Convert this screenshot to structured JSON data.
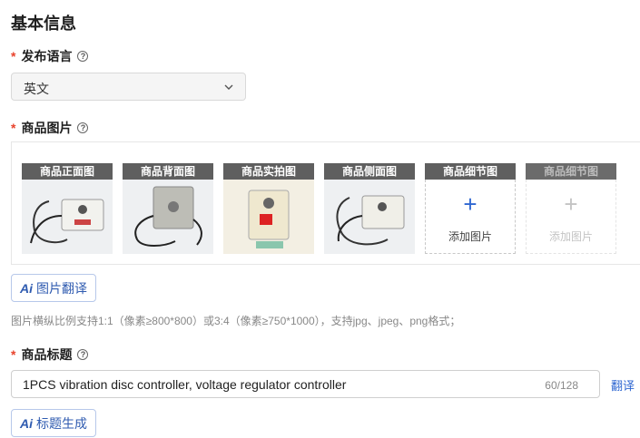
{
  "section_title": "基本信息",
  "language": {
    "label": "发布语言",
    "value": "英文"
  },
  "images": {
    "label": "商品图片",
    "slots": [
      {
        "title": "商品正面图"
      },
      {
        "title": "商品背面图"
      },
      {
        "title": "商品实拍图"
      },
      {
        "title": "商品侧面图"
      }
    ],
    "upload_slots": [
      {
        "title": "商品细节图",
        "text": "添加图片",
        "plus": "+",
        "enabled": true
      },
      {
        "title": "商品细节图",
        "text": "添加图片",
        "plus": "+",
        "enabled": false
      }
    ],
    "translate_button": "图片翻译",
    "hint": "图片横纵比例支持1:1（像素≥800*800）或3:4（像素≥750*1000），支持jpg、jpeg、png格式；"
  },
  "product_title": {
    "label": "商品标题",
    "value": "1PCS vibration disc controller, voltage regulator controller",
    "count": "60/128",
    "translate_link": "翻译",
    "generate_button": "标题生成"
  },
  "ai_mark": "Ai",
  "required_mark": "*",
  "help_mark": "?",
  "colors": {
    "accent": "#2f5bb0",
    "link": "#2f67d1",
    "required": "#e8432c",
    "slot_header": "#5f5f5f"
  }
}
